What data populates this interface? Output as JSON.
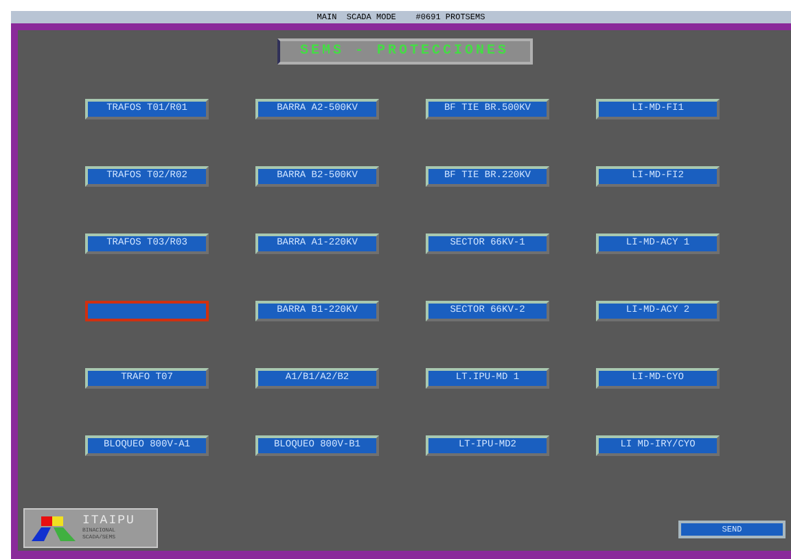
{
  "window": {
    "title": "MAIN  SCADA MODE    #0691 PROTSEMS"
  },
  "header": {
    "title": "SEMS - PROTECCIONES"
  },
  "buttons": [
    {
      "label": "TRAFOS T01/R01",
      "selected": false
    },
    {
      "label": "BARRA A2-500KV",
      "selected": false
    },
    {
      "label": "BF TIE BR.500KV",
      "selected": false
    },
    {
      "label": "LI-MD-FI1",
      "selected": false
    },
    {
      "label": "TRAFOS T02/R02",
      "selected": false
    },
    {
      "label": "BARRA B2-500KV",
      "selected": false
    },
    {
      "label": "BF TIE BR.220KV",
      "selected": false
    },
    {
      "label": "LI-MD-FI2",
      "selected": false
    },
    {
      "label": "TRAFOS T03/R03",
      "selected": false
    },
    {
      "label": "BARRA A1-220KV",
      "selected": false
    },
    {
      "label": "SECTOR 66KV-1",
      "selected": false
    },
    {
      "label": "LI-MD-ACY 1",
      "selected": false
    },
    {
      "selected": true
    },
    {
      "label": "BARRA B1-220KV",
      "selected": false
    },
    {
      "label": "SECTOR 66KV-2",
      "selected": false
    },
    {
      "label": "LI-MD-ACY 2",
      "selected": false
    },
    {
      "label": "TRAFO T07",
      "selected": false
    },
    {
      "label": "A1/B1/A2/B2",
      "selected": false
    },
    {
      "label": "LT.IPU-MD 1",
      "selected": false
    },
    {
      "label": "LI-MD-CYO",
      "selected": false
    },
    {
      "label": "BLOQUEO 800V-A1",
      "selected": false
    },
    {
      "label": "BLOQUEO 800V-B1",
      "selected": false
    },
    {
      "label": "LT-IPU-MD2",
      "selected": false
    },
    {
      "label": "LI MD-IRY/CYO",
      "selected": false
    }
  ],
  "logo": {
    "name": "ITAIPU",
    "line_1": "BINACIONAL",
    "line_2": "SCADA/SEMS"
  },
  "send_button": "SEND"
}
